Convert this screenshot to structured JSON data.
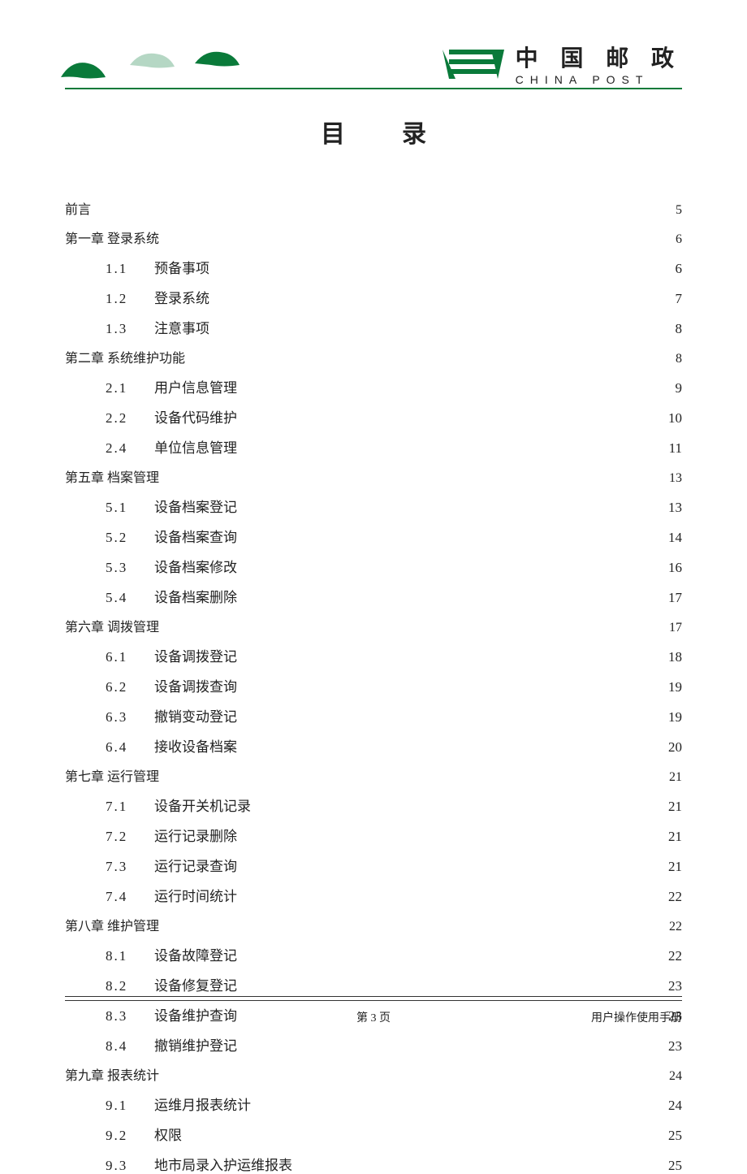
{
  "header": {
    "brand_cn": "中 国 邮 政",
    "brand_en": "CHINA POST"
  },
  "title": "目录",
  "footer": {
    "center": "第 3 页",
    "right": "用户操作使用手册"
  },
  "toc": [
    {
      "type": "chap",
      "label": "前言",
      "page": "5"
    },
    {
      "type": "chap",
      "label": "第一章  登录系统",
      "page": "6"
    },
    {
      "type": "sub",
      "num": "1.1",
      "label": "预备事项",
      "page": "6"
    },
    {
      "type": "sub",
      "num": "1.2",
      "label": "登录系统",
      "page": "7"
    },
    {
      "type": "sub",
      "num": "1.3",
      "label": "注意事项",
      "page": "8"
    },
    {
      "type": "chap",
      "label": "第二章  系统维护功能",
      "page": "8"
    },
    {
      "type": "sub",
      "num": "2.1",
      "label": "用户信息管理",
      "page": "9"
    },
    {
      "type": "sub",
      "num": "2.2",
      "label": "设备代码维护",
      "page": "10"
    },
    {
      "type": "sub",
      "num": "2.4",
      "label": "单位信息管理",
      "page": "11"
    },
    {
      "type": "chap",
      "label": "第五章  档案管理",
      "page": "13"
    },
    {
      "type": "sub",
      "num": "5.1",
      "label": "设备档案登记",
      "page": "13"
    },
    {
      "type": "sub",
      "num": "5.2",
      "label": "设备档案查询",
      "page": "14"
    },
    {
      "type": "sub",
      "num": "5.3",
      "label": "设备档案修改",
      "page": "16"
    },
    {
      "type": "sub",
      "num": "5.4",
      "label": "设备档案删除",
      "page": "17"
    },
    {
      "type": "chap",
      "label": "第六章  调拨管理",
      "page": "17"
    },
    {
      "type": "sub",
      "num": "6.1",
      "label": "设备调拨登记",
      "page": "18"
    },
    {
      "type": "sub",
      "num": "6.2",
      "label": "设备调拨查询",
      "page": "19"
    },
    {
      "type": "sub",
      "num": "6.3",
      "label": "撤销变动登记",
      "page": "19"
    },
    {
      "type": "sub",
      "num": "6.4",
      "label": "接收设备档案",
      "page": "20"
    },
    {
      "type": "chap",
      "label": "第七章  运行管理",
      "page": "21"
    },
    {
      "type": "sub",
      "num": "7.1",
      "label": "设备开关机记录",
      "page": "21"
    },
    {
      "type": "sub",
      "num": "7.2",
      "label": "运行记录删除",
      "page": "21"
    },
    {
      "type": "sub",
      "num": "7.3",
      "label": "运行记录查询",
      "page": "21"
    },
    {
      "type": "sub",
      "num": "7.4",
      "label": "运行时间统计",
      "page": "22"
    },
    {
      "type": "chap",
      "label": "第八章  维护管理",
      "page": "22"
    },
    {
      "type": "sub",
      "num": "8.1",
      "label": "设备故障登记",
      "page": "22"
    },
    {
      "type": "sub",
      "num": "8.2",
      "label": "设备修复登记",
      "page": "23"
    },
    {
      "type": "sub",
      "num": "8.3",
      "label": "设备维护查询",
      "page": "23"
    },
    {
      "type": "sub",
      "num": "8.4",
      "label": "撤销维护登记",
      "page": "23"
    },
    {
      "type": "chap",
      "label": "第九章  报表统计",
      "page": "24"
    },
    {
      "type": "sub",
      "num": "9.1",
      "label": "运维月报表统计",
      "page": "24"
    },
    {
      "type": "sub",
      "num": "9.2",
      "label": "权限",
      "page": "25"
    },
    {
      "type": "sub",
      "num": "9.3",
      "label": "地市局录入护运维报表",
      "page": "25"
    }
  ]
}
